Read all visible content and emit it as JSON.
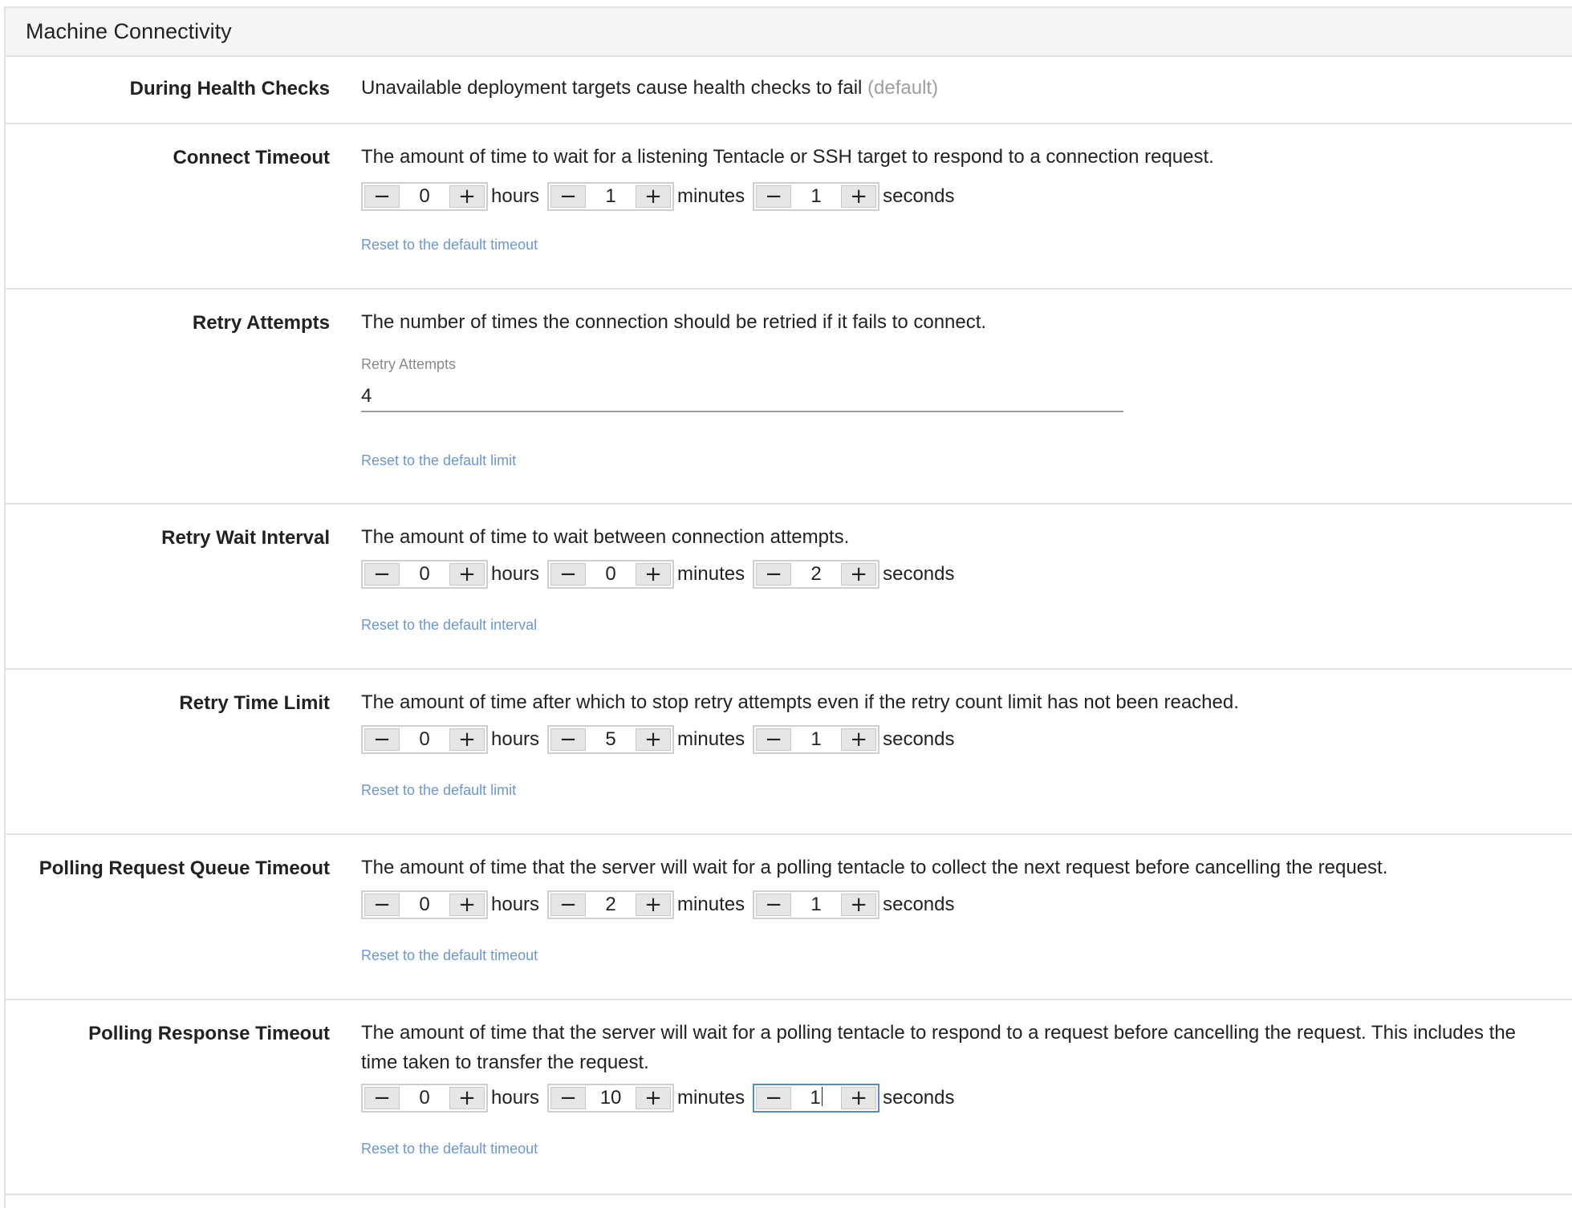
{
  "section": {
    "title": "Machine Connectivity"
  },
  "rows": {
    "health": {
      "label": "During Health Checks",
      "value": "Unavailable deployment targets cause health checks to fail",
      "suffix": "(default)"
    },
    "connect": {
      "label": "Connect Timeout",
      "description": "The amount of time to wait for a listening Tentacle or SSH target to respond to a connection request.",
      "hours": "0",
      "minutes": "1",
      "seconds": "1",
      "reset": "Reset to the default timeout"
    },
    "retry_attempts": {
      "label": "Retry Attempts",
      "description": "The number of times the connection should be retried if it fails to connect.",
      "field_label": "Retry Attempts",
      "value": "4",
      "reset": "Reset to the default limit"
    },
    "retry_wait": {
      "label": "Retry Wait Interval",
      "description": "The amount of time to wait between connection attempts.",
      "hours": "0",
      "minutes": "0",
      "seconds": "2",
      "reset": "Reset to the default interval"
    },
    "retry_limit": {
      "label": "Retry Time Limit",
      "description": "The amount of time after which to stop retry attempts even if the retry count limit has not been reached.",
      "hours": "0",
      "minutes": "5",
      "seconds": "1",
      "reset": "Reset to the default limit"
    },
    "queue": {
      "label": "Polling Request Queue Timeout",
      "description": "The amount of time that the server will wait for a polling tentacle to collect the next request before cancelling the request.",
      "hours": "0",
      "minutes": "2",
      "seconds": "1",
      "reset": "Reset to the default timeout"
    },
    "response": {
      "label": "Polling Response Timeout",
      "description": "The amount of time that the server will wait for a polling tentacle to respond to a request before cancelling the request. This includes the time taken to transfer the request.",
      "hours": "0",
      "minutes": "10",
      "seconds": "1",
      "reset": "Reset to the default timeout"
    }
  },
  "units": {
    "hours": "hours",
    "minutes": "minutes",
    "seconds": "seconds"
  },
  "controls": {
    "minus": "−",
    "plus": "+"
  },
  "icons": {
    "minus": "minus-icon",
    "plus": "plus-icon"
  },
  "colors": {
    "link": "#6a97d4",
    "focus": "#5b88c9",
    "border": "#e2e2e2"
  }
}
